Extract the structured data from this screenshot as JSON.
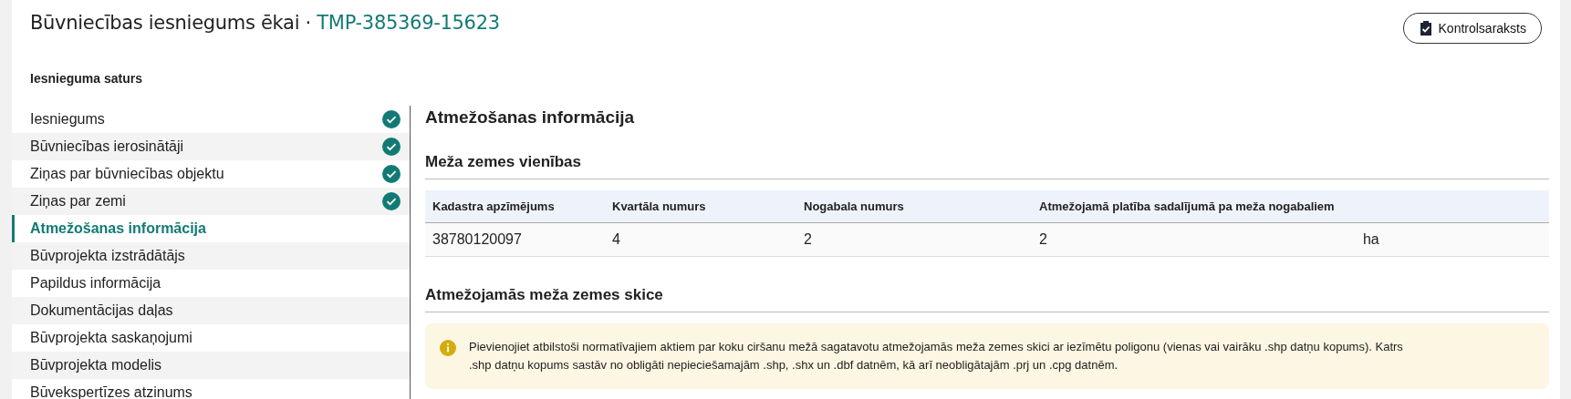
{
  "header": {
    "title": "Būvniecības iesniegums ēkai · ",
    "code": "TMP-385369-15623",
    "button": "Kontrolsaraksts"
  },
  "sidebar": {
    "title": "Iesnieguma saturs",
    "items": [
      {
        "label": "Iesniegums",
        "completed": true,
        "selected": false
      },
      {
        "label": "Būvniecības ierosinātāji",
        "completed": true,
        "selected": false
      },
      {
        "label": "Ziņas par būvniecības objektu",
        "completed": true,
        "selected": false
      },
      {
        "label": "Ziņas par zemi",
        "completed": true,
        "selected": false
      },
      {
        "label": "Atmežošanas informācija",
        "completed": false,
        "selected": true
      },
      {
        "label": "Būvprojekta izstrādātājs",
        "completed": false,
        "selected": false
      },
      {
        "label": "Papildus informācija",
        "completed": false,
        "selected": false
      },
      {
        "label": "Dokumentācijas daļas",
        "completed": false,
        "selected": false
      },
      {
        "label": "Būvprojekta saskaņojumi",
        "completed": false,
        "selected": false
      },
      {
        "label": "Būvprojekta modelis",
        "completed": false,
        "selected": false
      },
      {
        "label": "Būvekspertīzes atzinums",
        "completed": false,
        "selected": false
      }
    ]
  },
  "content": {
    "title": "Atmežošanas informācija",
    "units_section": {
      "title": "Meža zemes vienības",
      "table": {
        "columns": [
          "Kadastra apzīmējums",
          "Kvartāla numurs",
          "Nogabala numurs",
          "Atmežojamā platība sadalījumā pa meža nogabaliem"
        ],
        "rows": [
          {
            "cells": [
              "38780120097",
              "4",
              "2",
              "2"
            ],
            "unit": "ha"
          }
        ]
      }
    },
    "sketch_section": {
      "title": "Atmežojamās meža zemes skice",
      "notice": "Pievienojiet atbilstoši normatīvajiem aktiem par koku ciršanu mežā sagatavotu atmežojamās meža zemes skici ar iezīmētu poligonu (vienas vai vairāku .shp datņu kopums). Katrs .shp datņu kopums sastāv no obligāti nepieciešamajām .shp, .shx un .dbf datnēm, kā arī neobligātajām .prj un .cpg datnēm."
    }
  }
}
